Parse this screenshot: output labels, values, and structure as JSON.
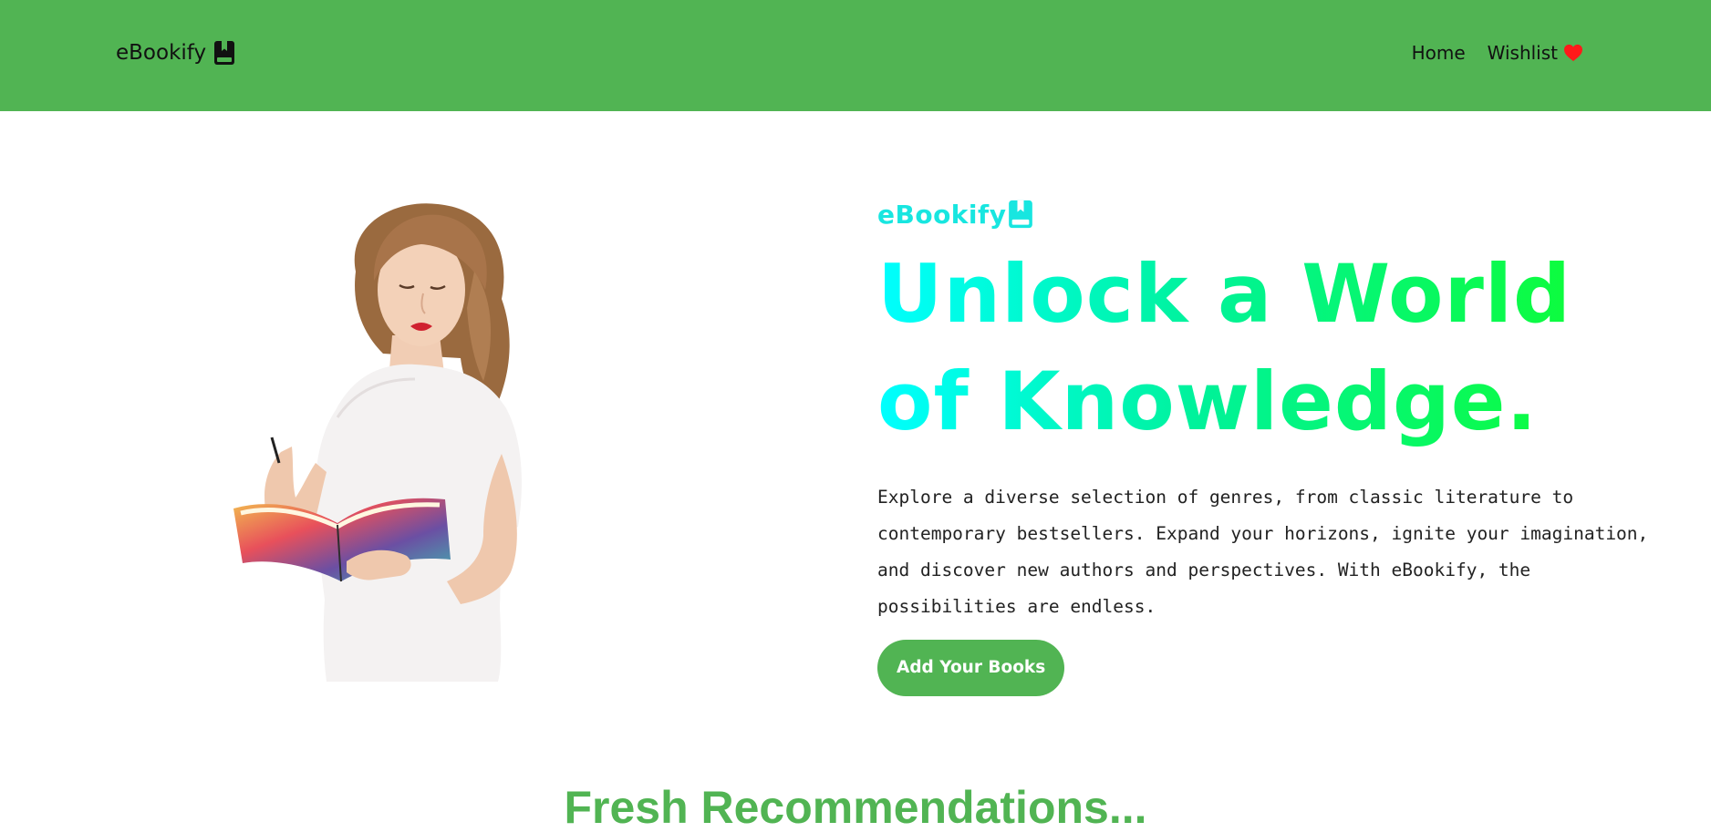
{
  "navbar": {
    "brand": "eBookify",
    "brand_icon": "book-bookmark-icon",
    "links": [
      {
        "label": "Home"
      },
      {
        "label": "Wishlist",
        "icon": "heart-icon",
        "icon_color": "#ff1a1a"
      }
    ],
    "background": "#51b453"
  },
  "hero": {
    "image_alt": "Woman in white t-shirt reading a colorful book",
    "eyebrow": "eBookify",
    "eyebrow_icon": "book-bookmark-icon",
    "eyebrow_color": "#18e6e0",
    "headline": "Unlock a World of Knowledge.",
    "headline_gradient": [
      "#00ffff",
      "#00f29a",
      "#11ff22"
    ],
    "description": "Explore a diverse selection of genres, from classic literature to contemporary bestsellers. Expand your horizons, ignite your imagination, and discover new authors and perspectives. With eBookify, the possibilities are endless.",
    "cta_label": "Add Your Books",
    "accent": "#51b453"
  },
  "section": {
    "title": "Fresh Recommendations..."
  }
}
